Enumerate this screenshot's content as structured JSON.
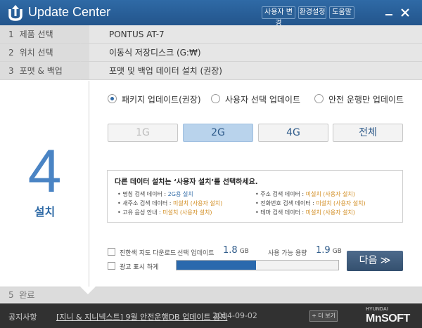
{
  "app": {
    "title": "Update Center"
  },
  "header_buttons": [
    "사용자 변경",
    "환경설정",
    "도움말"
  ],
  "window": {
    "minimize": "—",
    "close": "✕"
  },
  "steps": [
    {
      "num": "1",
      "label": "제품 선택",
      "value": "PONTUS AT-7"
    },
    {
      "num": "2",
      "label": "위치 선택",
      "value": "이동식 저장디스크 (G:₩)"
    },
    {
      "num": "3",
      "label": "포맷 & 백업",
      "value": "포맷 및 백업 데이터 설치 (권장)"
    }
  ],
  "current_step": {
    "num": "4",
    "label": "설치"
  },
  "update_options": {
    "items": [
      "패키지 업데이트(권장)",
      "사용자 선택 업데이트",
      "안전 운행만 업데이트"
    ],
    "selected": 0
  },
  "size_options": {
    "items": [
      "1G",
      "2G",
      "4G",
      "전체"
    ],
    "selected": 1,
    "disabled": [
      0
    ]
  },
  "info": {
    "title": "다른 데이터 설치는 ‘사용자 설치’를 선택하세요.",
    "left": [
      {
        "label": "• 명칭 검색 데이터 : ",
        "value": "2G용 설치",
        "installed": true
      },
      {
        "label": "• 새주소 검색 데이터 : ",
        "value": "미설치 (사용자 설치)",
        "installed": false
      },
      {
        "label": "• 고유 음성 안내 : ",
        "value": "미설치 (사용자 설치)",
        "installed": false
      }
    ],
    "right": [
      {
        "label": "• 주소 검색 데이터 : ",
        "value": "미설치 (사용자 설치)",
        "installed": false
      },
      {
        "label": "• 전화번호 검색 데이터 : ",
        "value": "미설치 (사용자 설치)",
        "installed": false
      },
      {
        "label": "• 테마 검색 데이터 : ",
        "value": "미설치 (사용자 설치)",
        "installed": false
      }
    ]
  },
  "bottom": {
    "check1": "진한색 지도 다운로드",
    "check2": "광고 표시 하게",
    "selected_update_label": "선택 업데이트",
    "selected_update_value": "1.8",
    "available_label": "사용 가능 용량",
    "available_value": "1.9",
    "unit": "GB",
    "progress": 0.49,
    "next_label": "다음 ≫"
  },
  "step5": {
    "num": "5",
    "label": "완료"
  },
  "footer": {
    "label": "공지사항",
    "notice": "[지니 & 지니넥스트] 9월 안전운행DB 업데이트 공지",
    "date": "2014-09-02",
    "more": "+ 더 보기",
    "brand_small": "HYUNDAI",
    "brand": "MnSOFT"
  },
  "colors": {
    "accent": "#2f6aa6",
    "title_bar": "#23558c",
    "footer_bg": "#313131",
    "pending": "#d18b1e"
  }
}
